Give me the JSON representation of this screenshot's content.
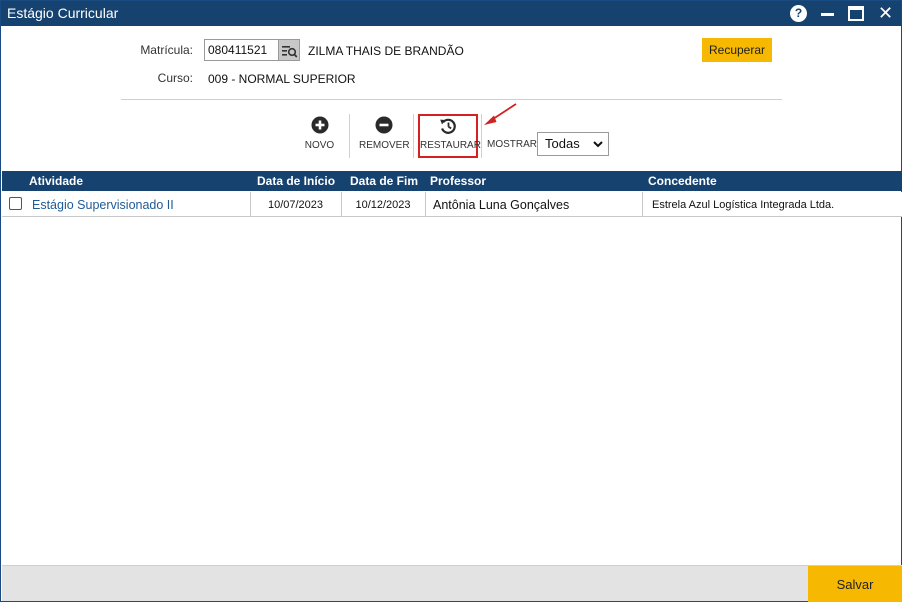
{
  "window": {
    "title": "Estágio Curricular"
  },
  "form": {
    "matricula_label": "Matrícula:",
    "matricula_value": "080411521",
    "student_name": "ZILMA THAIS DE BRANDÃO",
    "curso_label": "Curso:",
    "curso_value": "009 - NORMAL SUPERIOR",
    "recuperar_label": "Recuperar"
  },
  "toolbar": {
    "novo_label": "NOVO",
    "remover_label": "REMOVER",
    "restaurar_label": "RESTAURAR",
    "mostrar_label": "MOSTRAR:",
    "mostrar_selected": "Todas"
  },
  "grid": {
    "columns": [
      "Atividade",
      "Data de Início",
      "Data de Fim",
      "Professor",
      "Concedente"
    ],
    "rows": [
      {
        "atividade": "Estágio Supervisionado II",
        "data_inicio": "10/07/2023",
        "data_fim": "10/12/2023",
        "professor": "Antônia Luna Gonçalves",
        "concedente": "Estrela Azul Logística Integrada Ltda."
      }
    ]
  },
  "footer": {
    "salvar_label": "Salvar"
  },
  "colors": {
    "titlebar": "#16426f",
    "accent": "#f6b800",
    "annotation": "#d42020"
  }
}
